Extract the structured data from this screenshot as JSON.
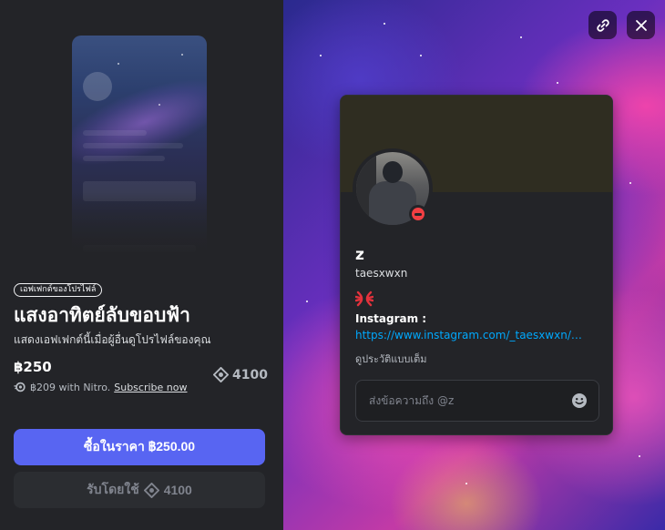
{
  "item": {
    "tag": "เอฟเฟกต์ของโปรไฟล์",
    "title": "แสงอาทิตย์ลับขอบฟ้า",
    "description": "แสดงเอฟเฟกต์นี้เมื่อผู้อื่นดูโปรไฟล์ของคุณ",
    "price": "฿250",
    "nitro_price": "฿209 with Nitro.",
    "subscribe_label": "Subscribe now",
    "orbs_price": "4100"
  },
  "buttons": {
    "buy_label": "ซื้อในราคา ฿250.00",
    "orbs_label_prefix": "รับโดยใช้",
    "orbs_value": "4100"
  },
  "profile": {
    "display_name": "z",
    "username": "taesxwxn",
    "bio_label": "Instagram :",
    "bio_link": "https://www.instagram.com/_taesxwxn/…",
    "full_profile_label": "ดูประวัติแบบเต็ม",
    "status": "do-not-disturb",
    "message_placeholder": "ส่งข้อความถึง @z"
  },
  "icons": {
    "copy_link": "link-icon",
    "close": "close-icon",
    "orb": "orb-icon",
    "nitro": "nitro-icon",
    "emoji": "emoji-icon",
    "badge": "anger-symbol-icon"
  },
  "colors": {
    "accent": "#5865f2",
    "link": "#00a8fc",
    "dnd": "#f23f43"
  }
}
